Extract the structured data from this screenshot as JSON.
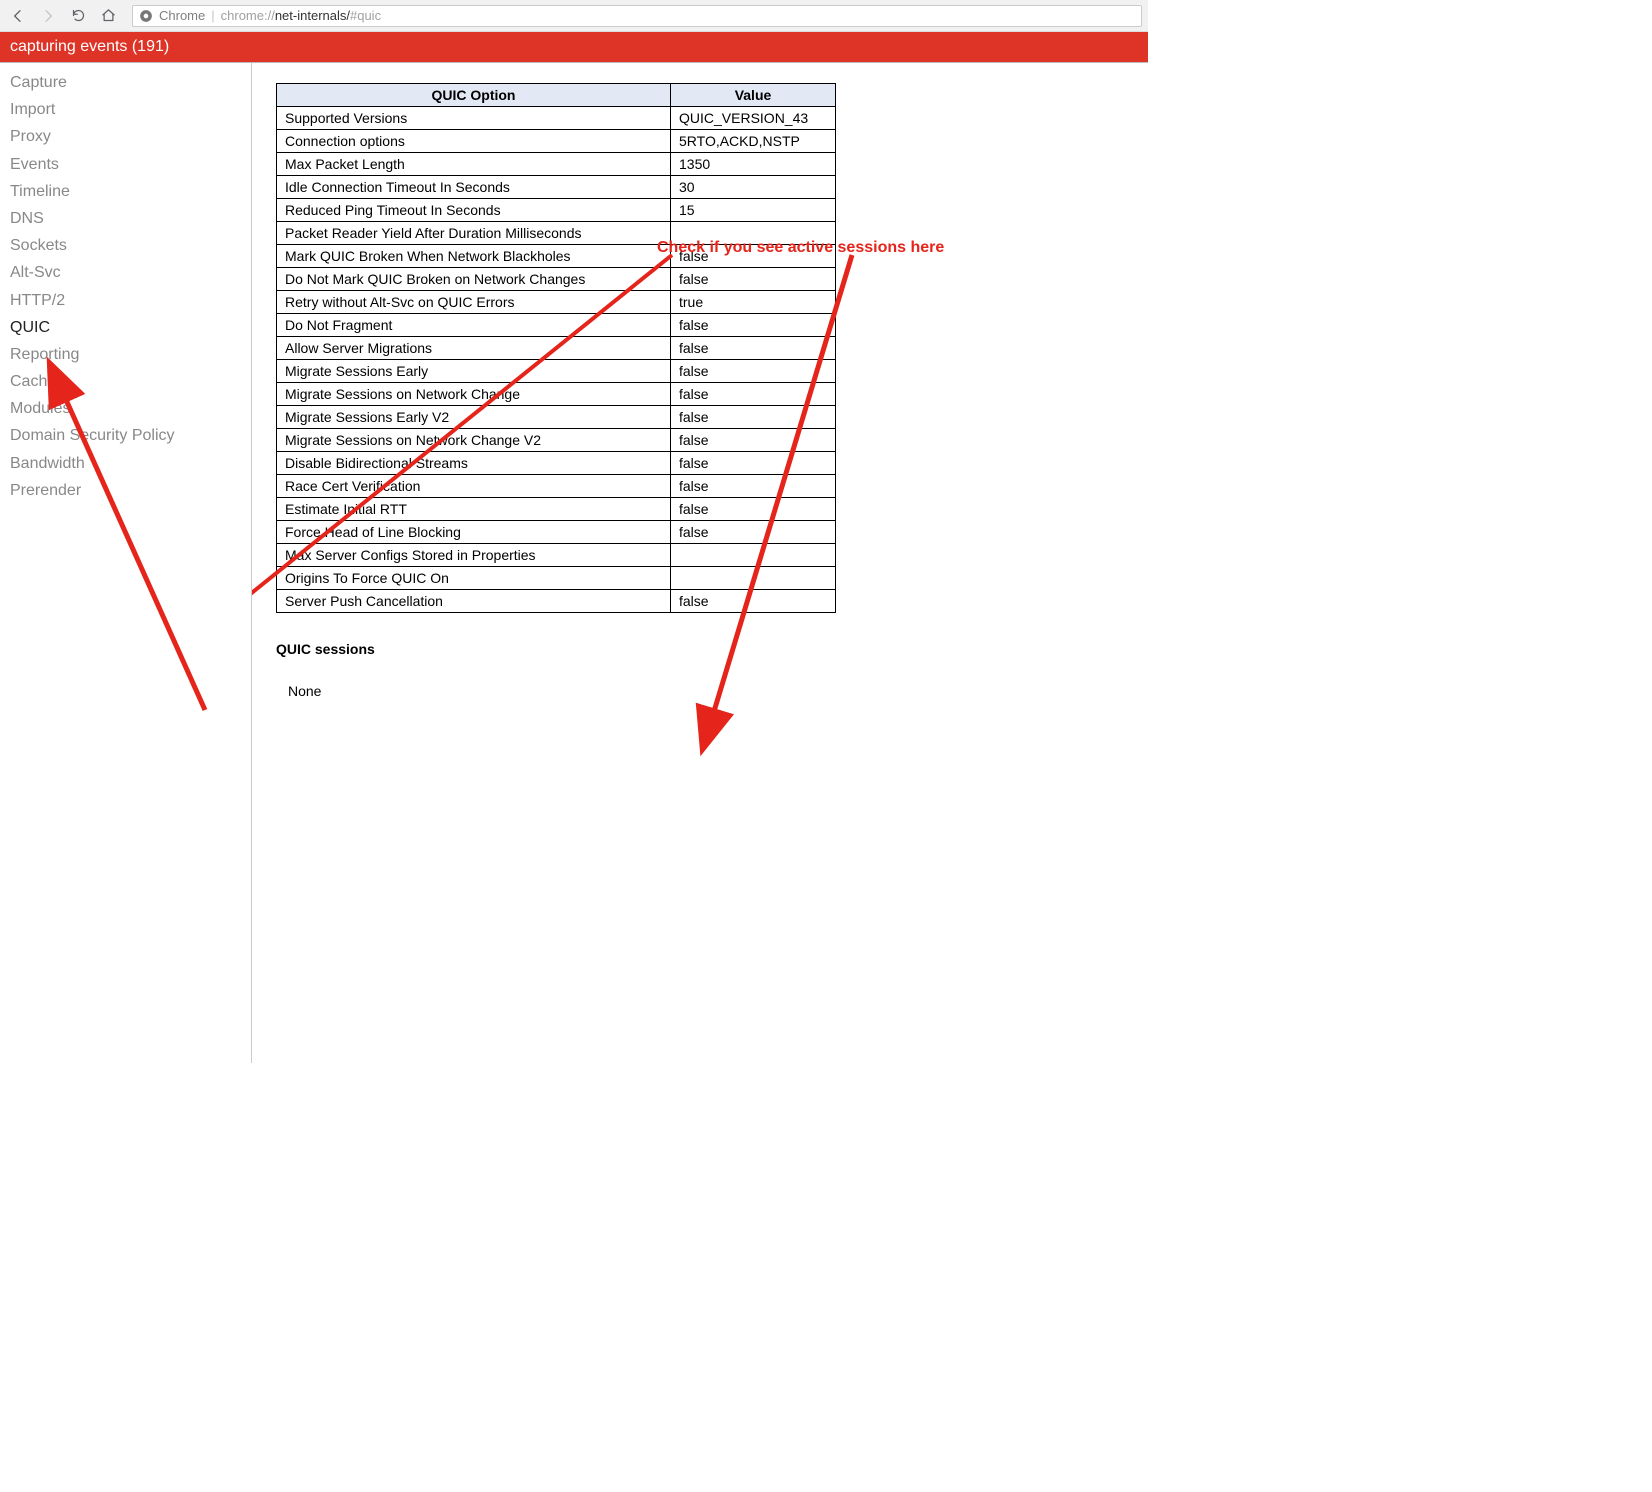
{
  "toolbar": {
    "browser_label": "Chrome",
    "url_light1": "chrome://",
    "url_dark": "net-internals/",
    "url_light2": "#quic"
  },
  "header": {
    "text": "capturing events (191)"
  },
  "sidebar": {
    "items": [
      {
        "label": "Capture",
        "active": false
      },
      {
        "label": "Import",
        "active": false
      },
      {
        "label": "Proxy",
        "active": false
      },
      {
        "label": "Events",
        "active": false
      },
      {
        "label": "Timeline",
        "active": false
      },
      {
        "label": "DNS",
        "active": false
      },
      {
        "label": "Sockets",
        "active": false
      },
      {
        "label": "Alt-Svc",
        "active": false
      },
      {
        "label": "HTTP/2",
        "active": false
      },
      {
        "label": "QUIC",
        "active": true
      },
      {
        "label": "Reporting",
        "active": false
      },
      {
        "label": "Cache",
        "active": false
      },
      {
        "label": "Modules",
        "active": false
      },
      {
        "label": "Domain Security Policy",
        "active": false
      },
      {
        "label": "Bandwidth",
        "active": false
      },
      {
        "label": "Prerender",
        "active": false
      }
    ]
  },
  "table": {
    "header_option": "QUIC Option",
    "header_value": "Value",
    "rows": [
      {
        "option": "Supported Versions",
        "value": "QUIC_VERSION_43"
      },
      {
        "option": "Connection options",
        "value": "5RTO,ACKD,NSTP"
      },
      {
        "option": "Max Packet Length",
        "value": "1350"
      },
      {
        "option": "Idle Connection Timeout In Seconds",
        "value": "30"
      },
      {
        "option": "Reduced Ping Timeout In Seconds",
        "value": "15"
      },
      {
        "option": "Packet Reader Yield After Duration Milliseconds",
        "value": ""
      },
      {
        "option": "Mark QUIC Broken When Network Blackholes",
        "value": "false"
      },
      {
        "option": "Do Not Mark QUIC Broken on Network Changes",
        "value": "false"
      },
      {
        "option": "Retry without Alt-Svc on QUIC Errors",
        "value": "true"
      },
      {
        "option": "Do Not Fragment",
        "value": "false"
      },
      {
        "option": "Allow Server Migrations",
        "value": "false"
      },
      {
        "option": "Migrate Sessions Early",
        "value": "false"
      },
      {
        "option": "Migrate Sessions on Network Change",
        "value": "false"
      },
      {
        "option": "Migrate Sessions Early V2",
        "value": "false"
      },
      {
        "option": "Migrate Sessions on Network Change V2",
        "value": "false"
      },
      {
        "option": "Disable Bidirectional Streams",
        "value": "false"
      },
      {
        "option": "Race Cert Verification",
        "value": "false"
      },
      {
        "option": "Estimate Initial RTT",
        "value": "false"
      },
      {
        "option": "Force Head of Line Blocking",
        "value": "false"
      },
      {
        "option": "Max Server Configs Stored in Properties",
        "value": ""
      },
      {
        "option": "Origins To Force QUIC On",
        "value": ""
      },
      {
        "option": "Server Push Cancellation",
        "value": "false"
      }
    ]
  },
  "sessions": {
    "heading": "QUIC sessions",
    "content": "None"
  },
  "annotation": {
    "text": "Check if you see active sessions here"
  }
}
